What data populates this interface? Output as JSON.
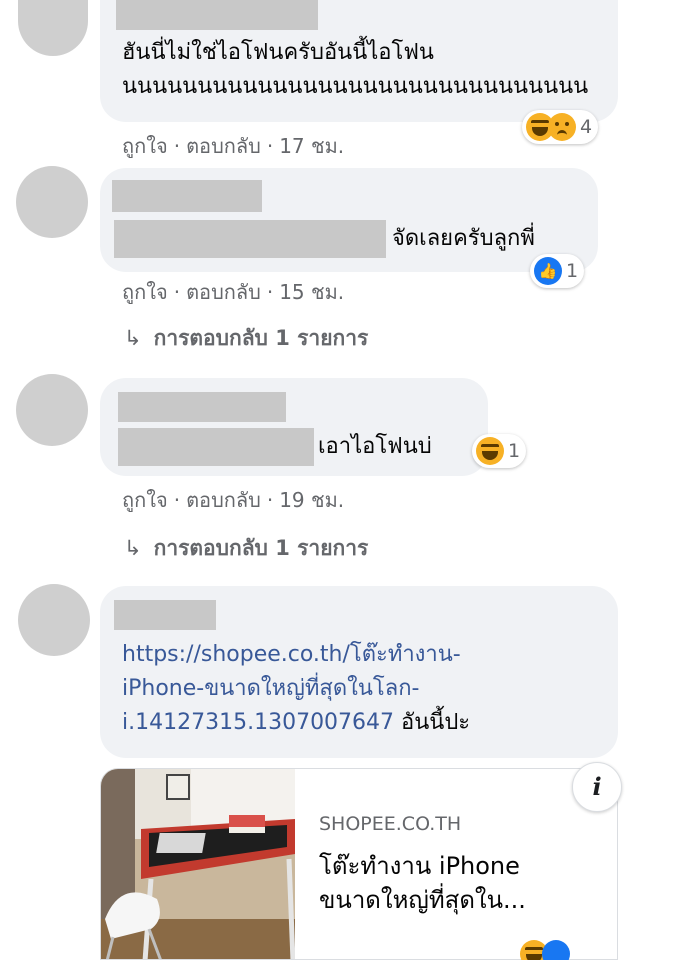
{
  "comments": [
    {
      "text_lines": [
        "ฮันนี่ไม่ใช่ไอโฟนครับอันนี้ไอโฟน",
        "นนนนนนนนนนนนนนนนนนนนนนนนนนนนนนน"
      ],
      "actions": {
        "like": "ถูกใจ",
        "reply": "ตอบกลับ",
        "time": "17 ชม."
      },
      "reactions": {
        "icons": [
          "haha",
          "sad"
        ],
        "count": "4"
      }
    },
    {
      "text": "จัดเลยครับลูกพี่",
      "actions": {
        "like": "ถูกใจ",
        "reply": "ตอบกลับ",
        "time": "15 ชม."
      },
      "reactions": {
        "icons": [
          "like"
        ],
        "count": "1"
      },
      "replies_label": "การตอบกลับ 1 รายการ"
    },
    {
      "text": "เอาไอโฟนบ่",
      "actions": {
        "like": "ถูกใจ",
        "reply": "ตอบกลับ",
        "time": "19 ชม."
      },
      "reactions": {
        "icons": [
          "haha"
        ],
        "count": "1"
      },
      "replies_label": "การตอบกลับ 1 รายการ"
    },
    {
      "link_lines": [
        "https://shopee.co.th/โต๊ะทำงาน-",
        "iPhone-ขนาดใหญ่ที่สุดในโลก-",
        "i.14127315.1307007647"
      ],
      "text_after_link": "อันนี้ปะ",
      "preview": {
        "domain": "SHOPEE.CO.TH",
        "title_lines": [
          "โต๊ะทำงาน iPhone",
          "ขนาดใหญ่ที่สุดใน..."
        ]
      }
    }
  ],
  "icons": {
    "reply_arrow": "↳",
    "info": "i"
  },
  "colors": {
    "bubble": "#f0f2f5",
    "link": "#385898",
    "meta": "#65676b",
    "like_blue": "#1877f2",
    "haha_yellow": "#f7b125"
  }
}
